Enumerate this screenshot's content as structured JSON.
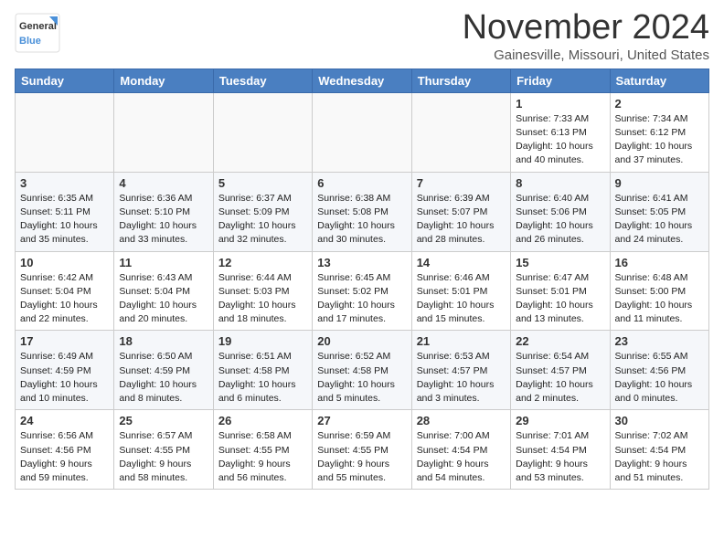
{
  "header": {
    "logo_general": "General",
    "logo_blue": "Blue",
    "month_title": "November 2024",
    "location": "Gainesville, Missouri, United States"
  },
  "days_of_week": [
    "Sunday",
    "Monday",
    "Tuesday",
    "Wednesday",
    "Thursday",
    "Friday",
    "Saturday"
  ],
  "weeks": [
    [
      {
        "day": "",
        "info": ""
      },
      {
        "day": "",
        "info": ""
      },
      {
        "day": "",
        "info": ""
      },
      {
        "day": "",
        "info": ""
      },
      {
        "day": "",
        "info": ""
      },
      {
        "day": "1",
        "info": "Sunrise: 7:33 AM\nSunset: 6:13 PM\nDaylight: 10 hours\nand 40 minutes."
      },
      {
        "day": "2",
        "info": "Sunrise: 7:34 AM\nSunset: 6:12 PM\nDaylight: 10 hours\nand 37 minutes."
      }
    ],
    [
      {
        "day": "3",
        "info": "Sunrise: 6:35 AM\nSunset: 5:11 PM\nDaylight: 10 hours\nand 35 minutes."
      },
      {
        "day": "4",
        "info": "Sunrise: 6:36 AM\nSunset: 5:10 PM\nDaylight: 10 hours\nand 33 minutes."
      },
      {
        "day": "5",
        "info": "Sunrise: 6:37 AM\nSunset: 5:09 PM\nDaylight: 10 hours\nand 32 minutes."
      },
      {
        "day": "6",
        "info": "Sunrise: 6:38 AM\nSunset: 5:08 PM\nDaylight: 10 hours\nand 30 minutes."
      },
      {
        "day": "7",
        "info": "Sunrise: 6:39 AM\nSunset: 5:07 PM\nDaylight: 10 hours\nand 28 minutes."
      },
      {
        "day": "8",
        "info": "Sunrise: 6:40 AM\nSunset: 5:06 PM\nDaylight: 10 hours\nand 26 minutes."
      },
      {
        "day": "9",
        "info": "Sunrise: 6:41 AM\nSunset: 5:05 PM\nDaylight: 10 hours\nand 24 minutes."
      }
    ],
    [
      {
        "day": "10",
        "info": "Sunrise: 6:42 AM\nSunset: 5:04 PM\nDaylight: 10 hours\nand 22 minutes."
      },
      {
        "day": "11",
        "info": "Sunrise: 6:43 AM\nSunset: 5:04 PM\nDaylight: 10 hours\nand 20 minutes."
      },
      {
        "day": "12",
        "info": "Sunrise: 6:44 AM\nSunset: 5:03 PM\nDaylight: 10 hours\nand 18 minutes."
      },
      {
        "day": "13",
        "info": "Sunrise: 6:45 AM\nSunset: 5:02 PM\nDaylight: 10 hours\nand 17 minutes."
      },
      {
        "day": "14",
        "info": "Sunrise: 6:46 AM\nSunset: 5:01 PM\nDaylight: 10 hours\nand 15 minutes."
      },
      {
        "day": "15",
        "info": "Sunrise: 6:47 AM\nSunset: 5:01 PM\nDaylight: 10 hours\nand 13 minutes."
      },
      {
        "day": "16",
        "info": "Sunrise: 6:48 AM\nSunset: 5:00 PM\nDaylight: 10 hours\nand 11 minutes."
      }
    ],
    [
      {
        "day": "17",
        "info": "Sunrise: 6:49 AM\nSunset: 4:59 PM\nDaylight: 10 hours\nand 10 minutes."
      },
      {
        "day": "18",
        "info": "Sunrise: 6:50 AM\nSunset: 4:59 PM\nDaylight: 10 hours\nand 8 minutes."
      },
      {
        "day": "19",
        "info": "Sunrise: 6:51 AM\nSunset: 4:58 PM\nDaylight: 10 hours\nand 6 minutes."
      },
      {
        "day": "20",
        "info": "Sunrise: 6:52 AM\nSunset: 4:58 PM\nDaylight: 10 hours\nand 5 minutes."
      },
      {
        "day": "21",
        "info": "Sunrise: 6:53 AM\nSunset: 4:57 PM\nDaylight: 10 hours\nand 3 minutes."
      },
      {
        "day": "22",
        "info": "Sunrise: 6:54 AM\nSunset: 4:57 PM\nDaylight: 10 hours\nand 2 minutes."
      },
      {
        "day": "23",
        "info": "Sunrise: 6:55 AM\nSunset: 4:56 PM\nDaylight: 10 hours\nand 0 minutes."
      }
    ],
    [
      {
        "day": "24",
        "info": "Sunrise: 6:56 AM\nSunset: 4:56 PM\nDaylight: 9 hours\nand 59 minutes."
      },
      {
        "day": "25",
        "info": "Sunrise: 6:57 AM\nSunset: 4:55 PM\nDaylight: 9 hours\nand 58 minutes."
      },
      {
        "day": "26",
        "info": "Sunrise: 6:58 AM\nSunset: 4:55 PM\nDaylight: 9 hours\nand 56 minutes."
      },
      {
        "day": "27",
        "info": "Sunrise: 6:59 AM\nSunset: 4:55 PM\nDaylight: 9 hours\nand 55 minutes."
      },
      {
        "day": "28",
        "info": "Sunrise: 7:00 AM\nSunset: 4:54 PM\nDaylight: 9 hours\nand 54 minutes."
      },
      {
        "day": "29",
        "info": "Sunrise: 7:01 AM\nSunset: 4:54 PM\nDaylight: 9 hours\nand 53 minutes."
      },
      {
        "day": "30",
        "info": "Sunrise: 7:02 AM\nSunset: 4:54 PM\nDaylight: 9 hours\nand 51 minutes."
      }
    ]
  ]
}
